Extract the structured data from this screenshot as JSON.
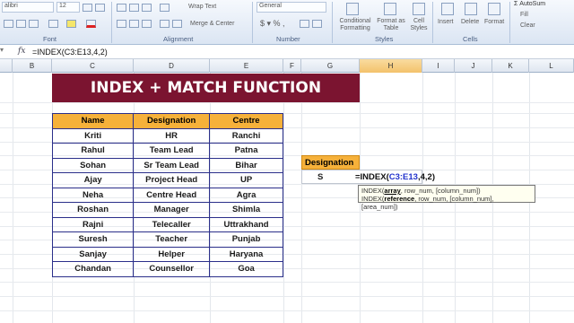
{
  "ribbon": {
    "font_name": "alibri",
    "font_size": "12",
    "wrap_text": "Wrap Text",
    "merge_center": "Merge & Center",
    "number_format": "General",
    "conditional_formatting": "Conditional Formatting",
    "format_as_table": "Format as Table",
    "cell_styles": "Cell Styles",
    "insert": "Insert",
    "delete": "Delete",
    "format": "Format",
    "autosum": "AutoSum",
    "fill": "Fill",
    "clear": "Clear",
    "groups": [
      "Font",
      "Alignment",
      "Number",
      "Styles",
      "Cells"
    ]
  },
  "formula_bar": {
    "fx": "fx",
    "content": "=INDEX(C3:E13,4,2)"
  },
  "columns": [
    "B",
    "C",
    "D",
    "E",
    "F",
    "G",
    "H",
    "I",
    "J",
    "K",
    "L"
  ],
  "banner": "INDEX + MATCH FUNCTION",
  "table": {
    "headers": [
      "Name",
      "Designation",
      "Centre"
    ],
    "rows": [
      [
        "Kriti",
        "HR",
        "Ranchi"
      ],
      [
        "Rahul",
        "Team Lead",
        "Patna"
      ],
      [
        "Sohan",
        "Sr Team Lead",
        "Bihar"
      ],
      [
        "Ajay",
        "Project Head",
        "UP"
      ],
      [
        "Neha",
        "Centre Head",
        "Agra"
      ],
      [
        "Roshan",
        "Manager",
        "Shimla"
      ],
      [
        "Rajni",
        "Telecaller",
        "Uttrakhand"
      ],
      [
        "Suresh",
        "Teacher",
        "Punjab"
      ],
      [
        "Sanjay",
        "Helper",
        "Haryana"
      ],
      [
        "Chandan",
        "Counsellor",
        "Goa"
      ]
    ]
  },
  "lookup": {
    "label": "Designation",
    "cell_partial": "S",
    "formula_prefix": "=INDEX(",
    "formula_range": "C3:E13",
    "formula_suffix": ",4,2)"
  },
  "tooltip": {
    "line1_fn": "INDEX(",
    "line1_bold": "array",
    "line1_rest": ", row_num, [column_num])",
    "line2_fn": "INDEX(",
    "line2_bold": "reference",
    "line2_rest": ", row_num, [column_num], [area_num])"
  }
}
